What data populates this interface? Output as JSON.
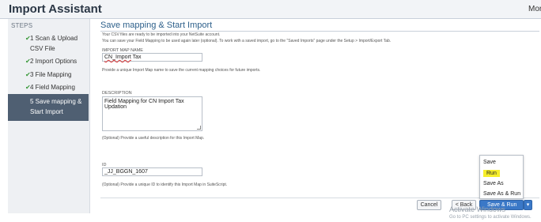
{
  "header": {
    "title": "Import Assistant",
    "more": "Mor"
  },
  "steps": {
    "heading": "STEPS",
    "items": [
      {
        "label": "1 Scan & Upload CSV File",
        "done": true
      },
      {
        "label": "2 Import Options",
        "done": true
      },
      {
        "label": "3 File Mapping",
        "done": true
      },
      {
        "label": "4 Field Mapping",
        "done": true
      },
      {
        "label": "5 Save mapping & Start Import",
        "done": false
      }
    ]
  },
  "main": {
    "title": "Save mapping & Start Import",
    "intro_1": "Your CSV files are ready to be imported into your NetSuite account.",
    "intro_2": "You can save your Field Mapping to be used again later (optional). To work with a saved import, go to the \"Saved Imports\" page under the Setup > Import/Export Tab.",
    "map_name": {
      "label": "IMPORT MAP NAME",
      "value_part1": "CN_Import",
      "value_part2": " Tax",
      "hint": "Provide a unique Import Map name to save the current mapping choices for future imports."
    },
    "description": {
      "label": "DESCRIPTION",
      "value": "Field Mapping for CN Import Tax Updation",
      "hint": "(Optional) Provide a useful description for this Import Map."
    },
    "id": {
      "label": "ID",
      "value": "_JJ_BGGN_1607",
      "hint": "(Optional) Provide a unique ID to identify this Import Map in SuiteScript."
    }
  },
  "buttons": {
    "cancel": "Cancel",
    "back": "< Back",
    "save_run": "Save & Run",
    "caret": "▾"
  },
  "dropdown": {
    "items": [
      "Save",
      "Run",
      "Save As",
      "Save As & Run"
    ],
    "highlighted_index": 1
  },
  "watermark": {
    "line1": "Activate Windows",
    "line2": "Go to PC settings to activate Windows."
  },
  "colors": {
    "primary_button": "#3a78c7",
    "active_step": "#4f5f72",
    "highlight": "#f6ee2a",
    "title_blue": "#2c5f8a"
  }
}
